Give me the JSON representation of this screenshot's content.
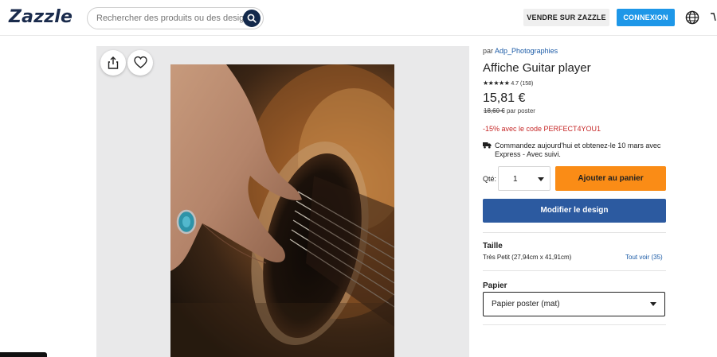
{
  "header": {
    "logo": "Zazzle",
    "search_placeholder": "Rechercher des produits ou des designs",
    "sell_label": "VENDRE SUR ZAZZLE",
    "login_label": "CONNEXION"
  },
  "product": {
    "by_prefix": "par",
    "designer": "Adp_Photographies",
    "title": "Affiche Guitar player",
    "stars": "★★★★★",
    "rating": "4.7",
    "reviews": "(158)",
    "price": "15,81 €",
    "old_price": "18,60 €",
    "per_unit": "par poster",
    "promo": "-15% avec le code PERFECT4YOU1",
    "shipping": "Commandez aujourd'hui et obtenez-le 10 mars avec Express - Avec suivi.",
    "qty_label": "Qté:",
    "qty_value": "1",
    "add_to_cart": "Ajouter au panier",
    "edit_design": "Modifier le design",
    "size_label": "Taille",
    "size_value": "Très Petit (27,94cm x 41,91cm)",
    "size_link": "Tout voir (35)",
    "paper_label": "Papier",
    "paper_value": "Papier poster (mat)"
  },
  "colors": {
    "brand_navy": "#13294b",
    "login_blue": "#1e97e8",
    "add_orange": "#fa8c16",
    "edit_blue": "#2c5aa0",
    "promo_red": "#c62828"
  },
  "icons": [
    "search-icon",
    "globe-icon",
    "share-icon",
    "heart-icon",
    "truck-icon",
    "chevron-down-icon"
  ]
}
